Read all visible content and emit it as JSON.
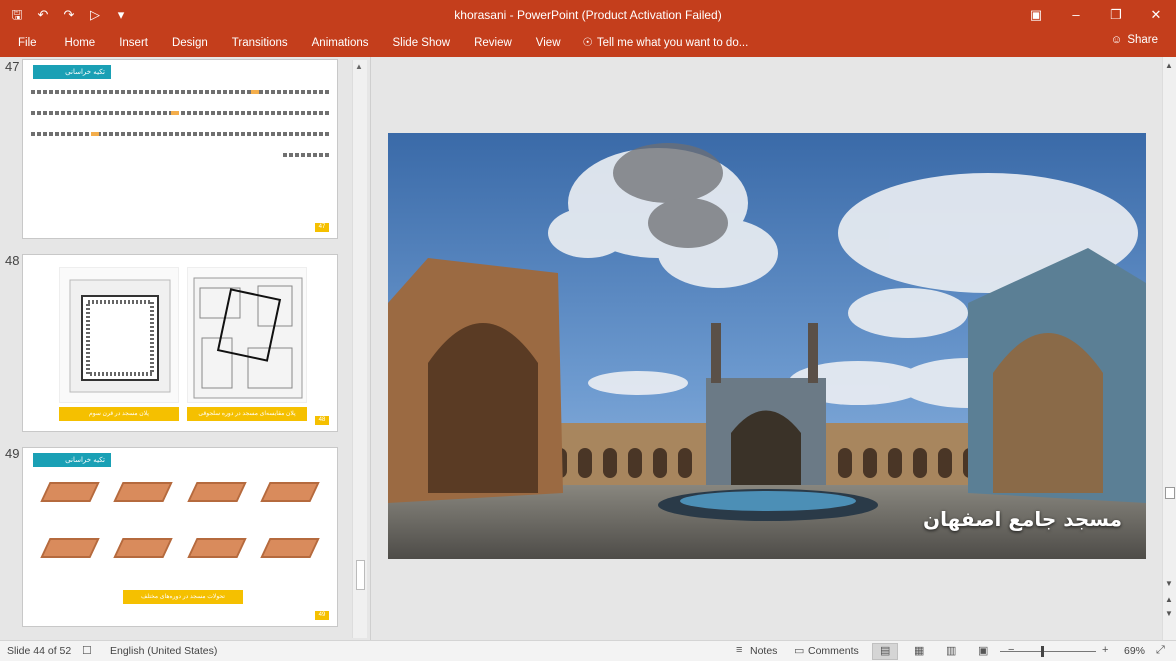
{
  "app": {
    "title": "khorasani - PowerPoint (Product Activation Failed)"
  },
  "qat": {
    "save_icon": "save-icon",
    "undo_icon": "undo-icon",
    "redo_icon": "redo-icon",
    "start_icon": "start-from-beginning-icon",
    "customize_icon": "customize-qat-icon"
  },
  "ribbon": {
    "tabs": [
      "File",
      "Home",
      "Insert",
      "Design",
      "Transitions",
      "Animations",
      "Slide Show",
      "Review",
      "View"
    ],
    "tell_me": "Tell me what you want to do...",
    "share": "Share"
  },
  "thumbnails": [
    {
      "number": "47",
      "header": "تکیه خراسانی",
      "badge": "47"
    },
    {
      "number": "48",
      "captions": [
        "پلان مسجد در قرن سوم",
        "پلان مقایسه‌ای مسجد در دوره سلجوقی"
      ],
      "badge": "48"
    },
    {
      "number": "49",
      "header": "تکیه خراسانی",
      "bottom_caption": "تحولات مسجد در دوره‌های مختلف",
      "badge": "49"
    }
  ],
  "slide": {
    "caption": "مسجد جامع اصفهان"
  },
  "status": {
    "slide_counter": "Slide 44 of 52",
    "language": "English (United States)",
    "notes": "Notes",
    "comments": "Comments",
    "zoom": "69%"
  },
  "colors": {
    "accent": "#c43e1c",
    "thumb_header": "#1aa0b5",
    "thumb_badge": "#f5c000"
  }
}
